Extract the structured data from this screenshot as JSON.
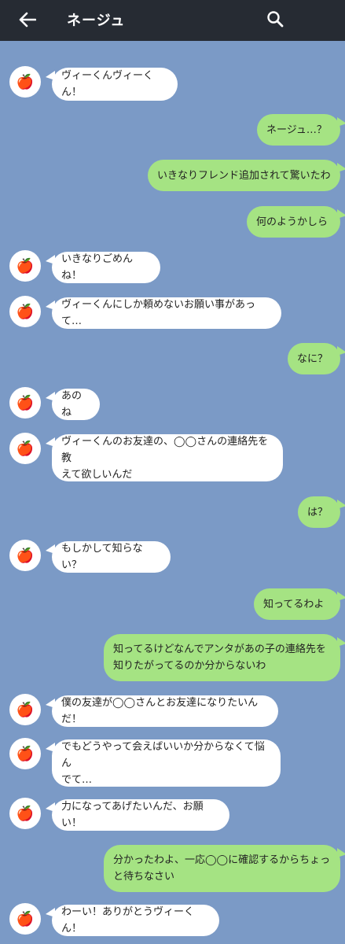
{
  "header": {
    "title": "ネージュ",
    "back_icon": "back-arrow-icon",
    "search_icon": "search-icon"
  },
  "colors": {
    "header_bg": "#262b33",
    "chat_bg": "#7b9ac6",
    "received_bubble": "#ffffff",
    "sent_bubble": "#a5e383"
  },
  "avatar": {
    "icon": "apple-icon",
    "glyph": "🍎"
  },
  "messages": [
    {
      "side": "received",
      "text": "ヴィーくんヴィーくん！"
    },
    {
      "side": "sent",
      "text": "ネージュ…？"
    },
    {
      "side": "sent",
      "text": "いきなりフレンド追加されて驚いたわ"
    },
    {
      "side": "sent",
      "text": "何のようかしら"
    },
    {
      "side": "received",
      "text": "いきなりごめんね！"
    },
    {
      "side": "received",
      "text": "ヴィーくんにしか頼めないお願い事があって…"
    },
    {
      "side": "sent",
      "text": "なに？"
    },
    {
      "side": "received",
      "text": "あのね"
    },
    {
      "side": "received",
      "text": "ヴィーくんのお友達の、◯◯さんの連絡先を教\nえて欲しいんだ"
    },
    {
      "side": "sent",
      "text": "は？"
    },
    {
      "side": "received",
      "text": "もしかして知らない？"
    },
    {
      "side": "sent",
      "text": "知ってるわよ"
    },
    {
      "side": "sent",
      "text": "知ってるけどなんでアンタがあの子の連絡先を\n知りたがってるのか分からないわ"
    },
    {
      "side": "received",
      "text": "僕の友達が◯◯さんとお友達になりたいんだ！"
    },
    {
      "side": "received",
      "text": "でもどうやって会えばいいか分からなくて悩ん\nでて…"
    },
    {
      "side": "received",
      "text": "力になってあげたいんだ、お願い！"
    },
    {
      "side": "sent",
      "text": "分かったわよ、一応◯◯に確認するからちょっ\nと待ちなさい"
    },
    {
      "side": "received",
      "text": "わーい！ありがとうヴィーくん！"
    }
  ]
}
